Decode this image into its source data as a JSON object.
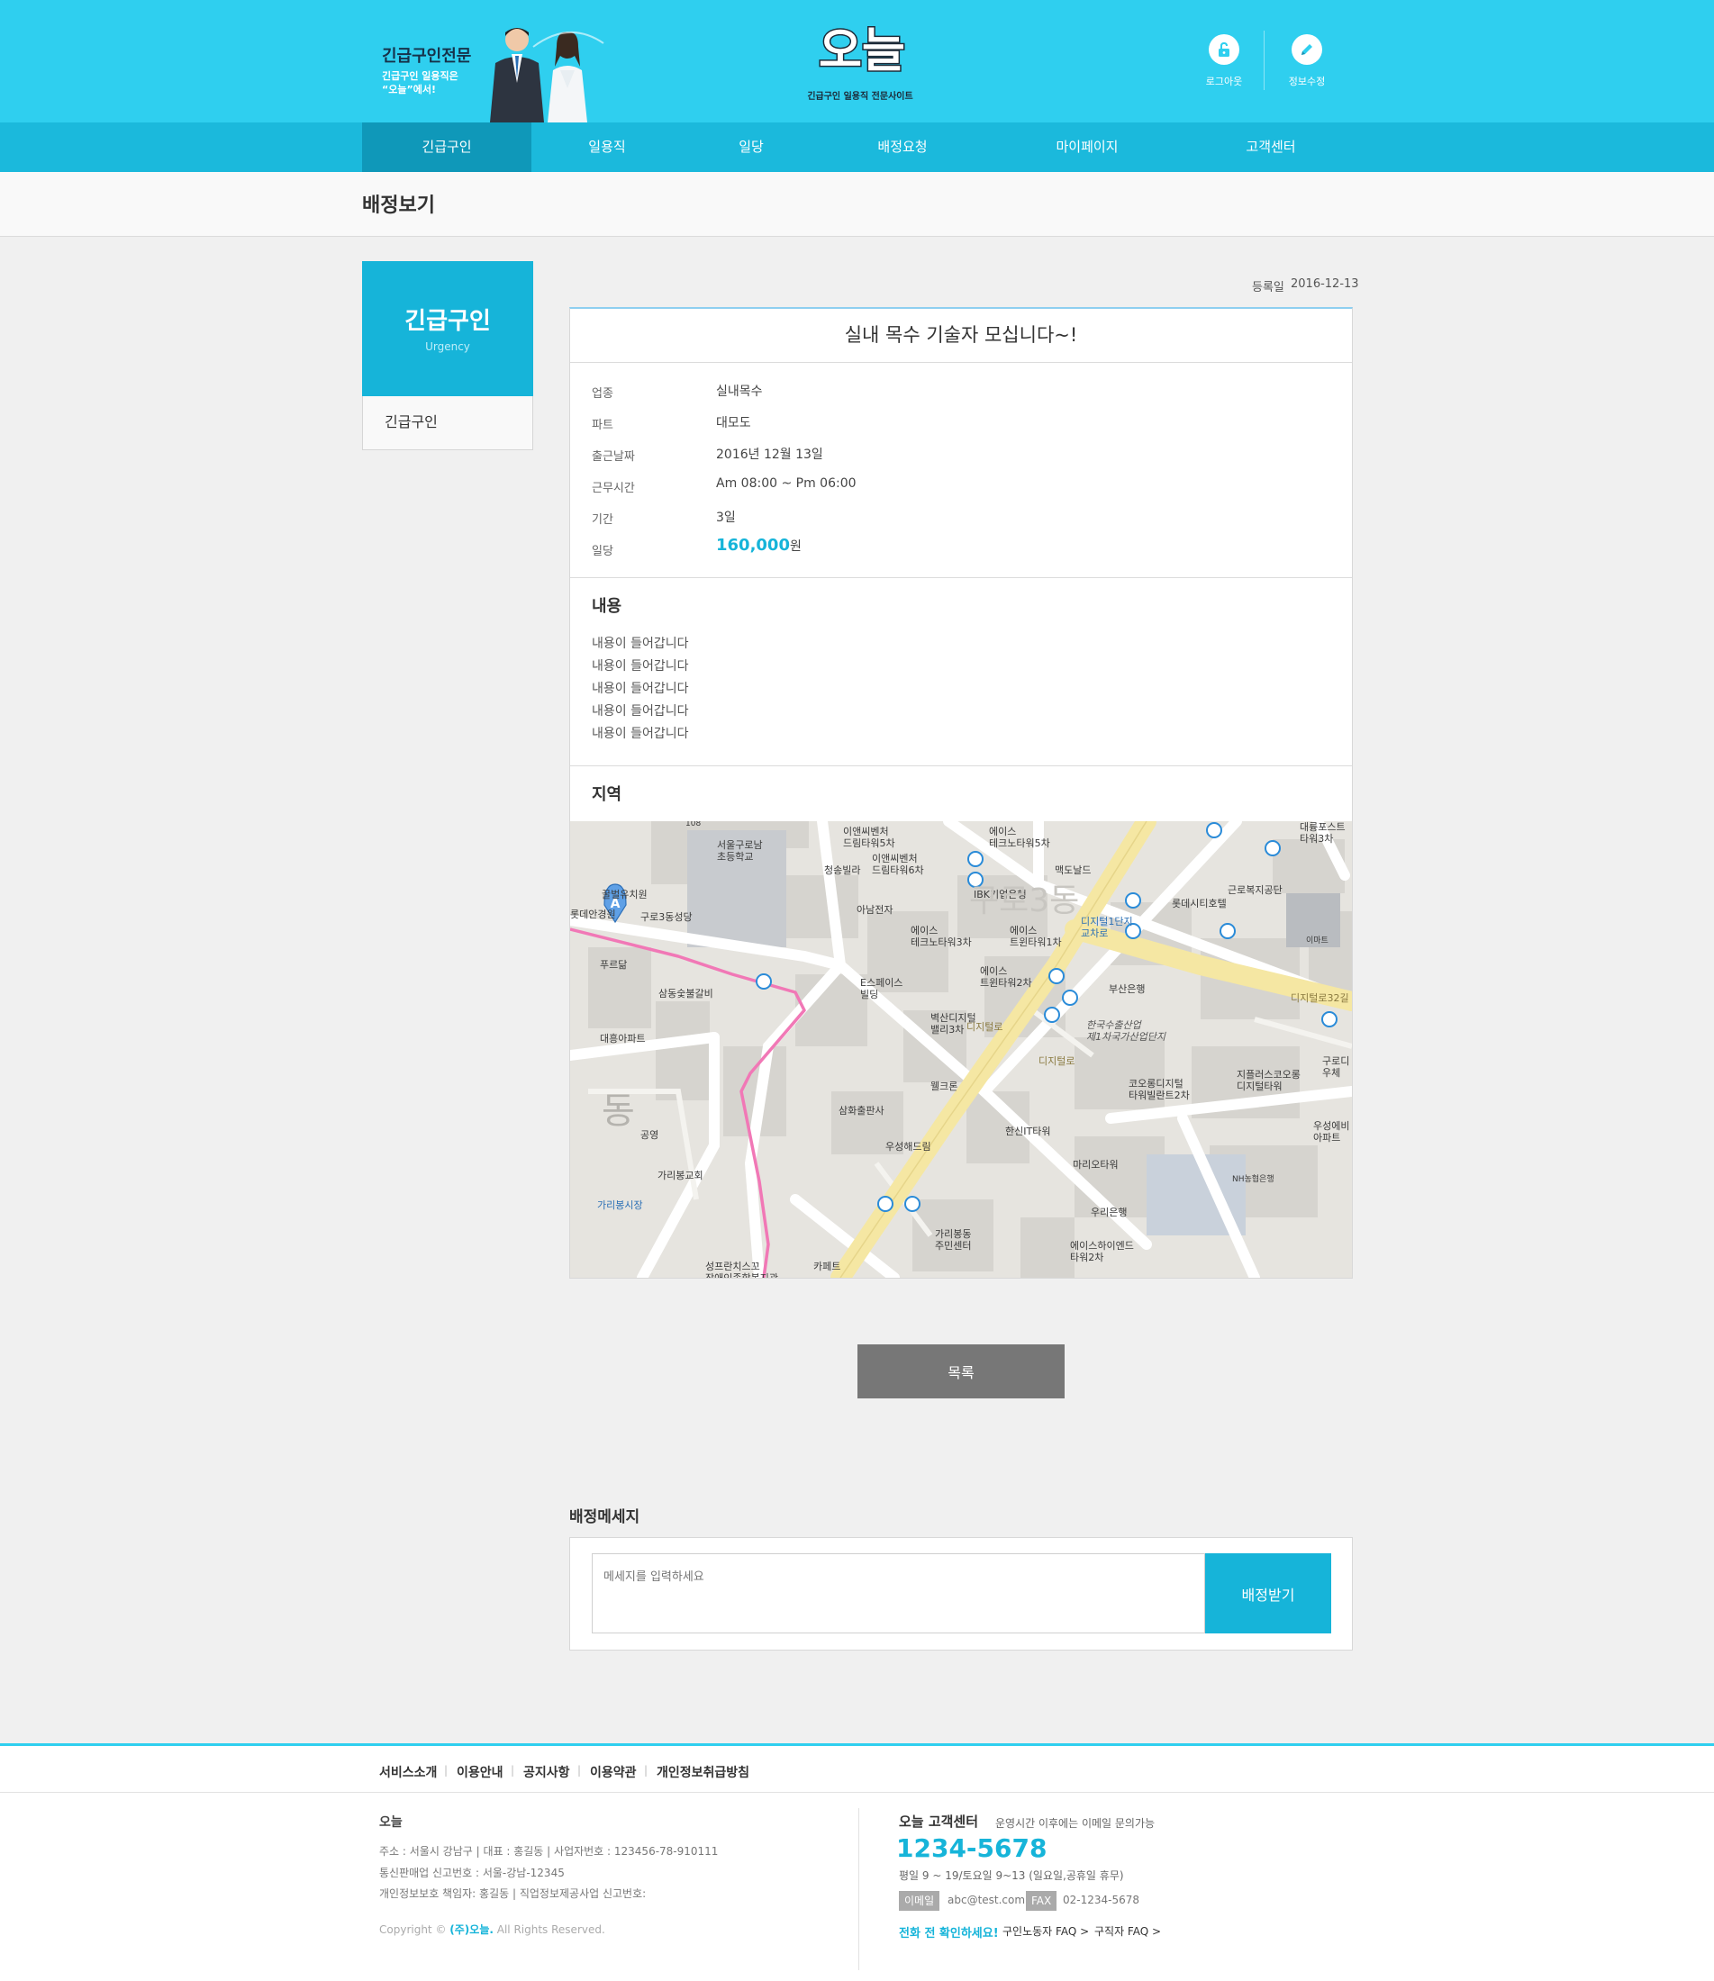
{
  "header": {
    "tagline_title": "긴급구인전문",
    "tagline_sub1": "긴급구인 일용직은",
    "tagline_sub2": "“오늘”에서!",
    "logo_text": "오늘",
    "logo_subtitle": "긴급구인 일용직 전문사이트",
    "logout_label": "로그아웃",
    "edit_info_label": "정보수정",
    "accent_color": "#2fcfef"
  },
  "nav": {
    "items": [
      "긴급구인",
      "일용직",
      "일당",
      "배정요청",
      "마이페이지",
      "고객센터"
    ],
    "active": "긴급구인"
  },
  "page": {
    "title": "배정보기"
  },
  "sidebar": {
    "title": "긴급구인",
    "subtitle": "Urgency",
    "items": [
      "긴급구인"
    ]
  },
  "post": {
    "reg_label": "등록일",
    "reg_date": "2016-12-13",
    "title": "실내 목수 기술자 모십니다~!",
    "details": [
      {
        "label": "업종",
        "value": "실내목수"
      },
      {
        "label": "파트",
        "value": "대모도"
      },
      {
        "label": "출근날짜",
        "value": "2016년 12월 13일"
      },
      {
        "label": "근무시간",
        "value": "Am 08:00 ~ Pm 06:00"
      },
      {
        "label": "기간",
        "value": "3일"
      }
    ],
    "wage_label": "일당",
    "wage_value": "160,000",
    "wage_unit": "원",
    "content_title": "내용",
    "content_lines": [
      "내용이 들어갑니다",
      "내용이 들어갑니다",
      "내용이 들어갑니다",
      "내용이 들어갑니다",
      "내용이 들어갑니다"
    ],
    "region_title": "지역"
  },
  "map": {
    "marker": "A",
    "labels": {
      "school": "서울구로남\n초등학교",
      "kindergarten": "꿀벌유치원",
      "cathedral": "구로3동성당",
      "lotte": "롯데안경원",
      "pururun": "푸르닮",
      "samdong": "삼동숯불갈비",
      "daeheung": "대흥아파트",
      "dong": "동",
      "park": "공영",
      "church": "가리봉교회",
      "market": "가리봉시장",
      "sungpranchis": "성프란치스꼬\n장애인종합복지관",
      "caffe": "카페트",
      "ace1": "에이스\n테크노타워5차",
      "ace2": "이앤씨벤처\n드림타워6차",
      "ace3": "이앤씨벤처\n드림타워5차",
      "cheongsong": "청송빌라",
      "anam": "아남전자",
      "ace4": "에이스\n테크노타워3차",
      "ibk": "IBK기업은행",
      "ace5": "에이스\n트윈타워1차",
      "eseu": "E스페이스\n빌딩",
      "ace6": "에이스\n트윈타워2차",
      "baeksan": "벽산디지털\n밸리3차",
      "wellcron": "웰크론",
      "samhwa": "삼화출판사",
      "wooseong": "우성해드림",
      "hansin": "한신IT타워",
      "garibong_center": "가리봉동\n주민센터",
      "mario": "마리오타워",
      "woori": "우리은행",
      "acehigh": "에이스하이엔드\n타워2차",
      "mcdonalds": "맥도날드",
      "guro3": "구로3동",
      "digital_cross": "디지털1단지\n교차로",
      "lotte_city": "롯데시티호텔",
      "labor": "근로복지공단",
      "emart": "이마트",
      "busan_bank": "부산은행",
      "hanguk": "한국수출산업\n제1차국가산업단지",
      "kolon": "코오롱디지털\n타워빌란트2차",
      "jplus": "지플러스코오롱\n디지털타워",
      "nh": "NH농협은행",
      "daeryung": "대륭포스트\n타워3차",
      "digital_road": "디지털로32길",
      "guro_digi": "구로디\n우체",
      "wooseong_apt": "우성에비\n아파트",
      "sign": "108",
      "road1": "디지털로",
      "road2": "디지털로"
    }
  },
  "buttons": {
    "list_label": "목록"
  },
  "message": {
    "title": "배정메세지",
    "placeholder": "메세지를 입력하세요",
    "submit_label": "배정받기"
  },
  "footer": {
    "links": [
      "서비스소개",
      "이용안내",
      "공지사항",
      "이용약관",
      "개인정보취급방침"
    ],
    "company_name": "오늘",
    "info_line1": "주소 : 서울시 강남구  |  대표 : 홍길동  |  사업자번호 : 123456-78-910111",
    "info_line2": "통신판매업 신고번호 : 서울-강남-12345",
    "info_line3": "개인정보보호 책임자: 홍길동 | 직업정보제공사업 신고번호:",
    "copyright_prefix": "Copyright ©",
    "copyright_brand": "(주)오늘.",
    "copyright_suffix": "All Rights Reserved.",
    "cs_title": "오늘 고객센터",
    "cs_note": "운영시간 이후에는 이메일 문의가능",
    "phone": "1234-5678",
    "hours": "평일 9 ~ 19/토요일 9~13 (일요일,공휴일 휴무)",
    "email_label": "이메일",
    "email_value": "abc@test.com",
    "fax_label": "FAX",
    "fax_value": "02-1234-5678",
    "confirm_text": "전화 전 확인하세요!",
    "faq1": "구인노동자 FAQ >",
    "faq2": "구직자 FAQ >"
  }
}
